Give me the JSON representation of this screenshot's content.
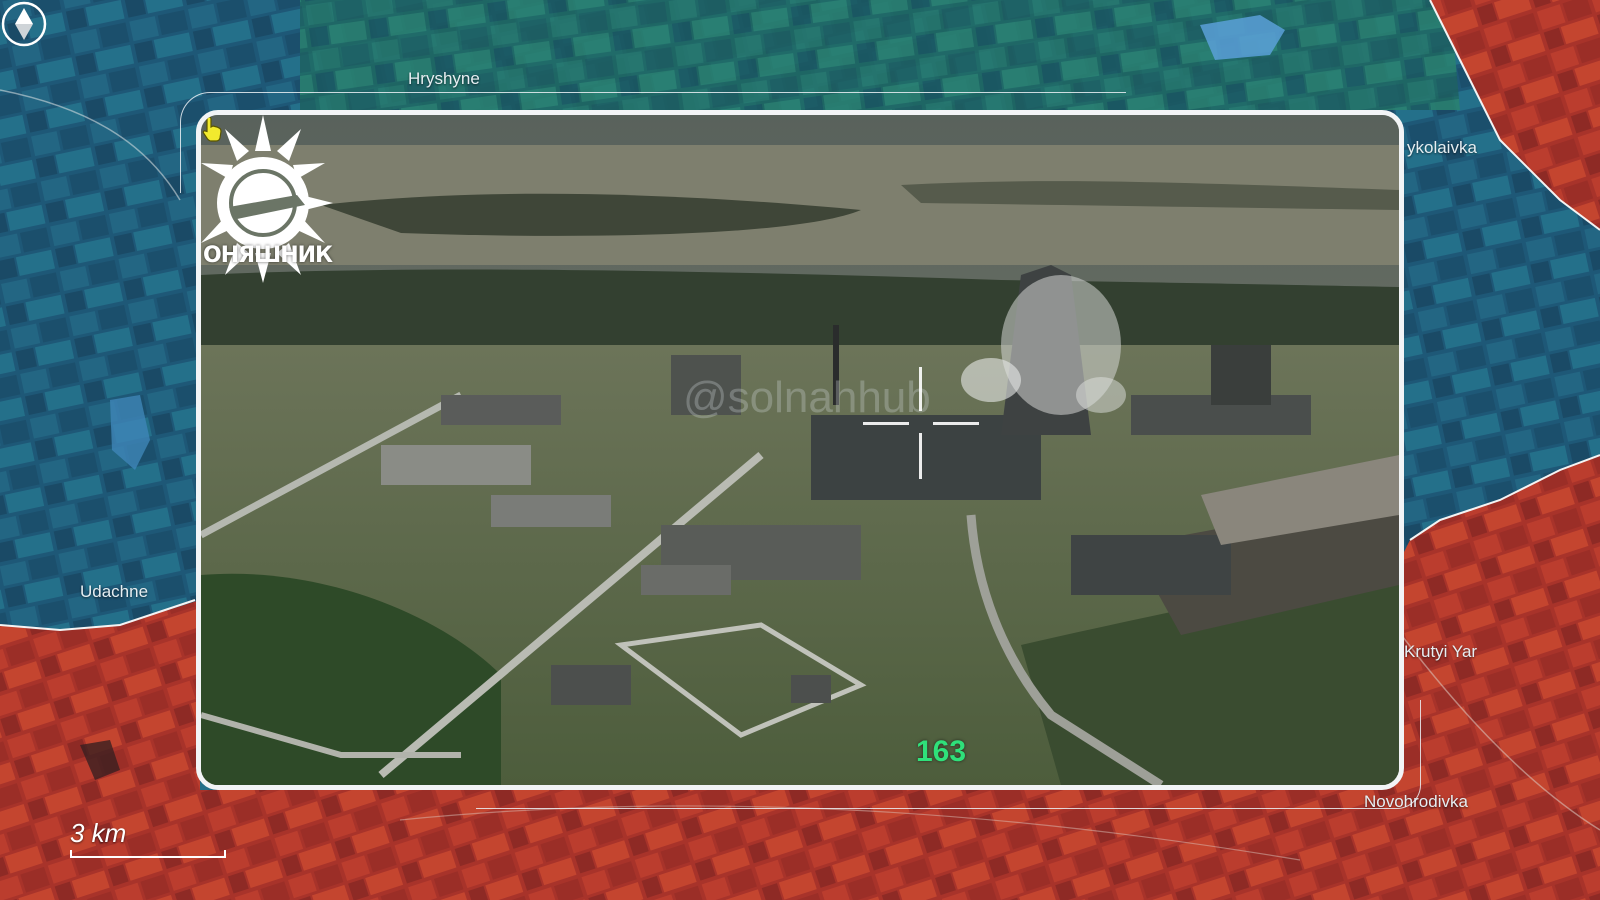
{
  "map": {
    "places": [
      {
        "id": "hryshyne",
        "label": "Hryshyne"
      },
      {
        "id": "mykolaivka",
        "label": "ykolaivka"
      },
      {
        "id": "udachne",
        "label": "Udachne"
      },
      {
        "id": "krutyi-yar",
        "label": "Krutyi Yar"
      },
      {
        "id": "novohrodivka",
        "label": "Novohrodivka"
      }
    ],
    "scale": {
      "label": "3 km"
    },
    "colors": {
      "controlled_blue": "#1f5a7a",
      "controlled_red": "#b8382a",
      "frame": "#f2f4f6"
    },
    "compass": {
      "icon": "compass-north-icon"
    }
  },
  "video": {
    "logo_text": "ОНЯШНИК",
    "watermark": "@solnahhub",
    "counter": "163",
    "counter_color": "#2fe07a"
  }
}
